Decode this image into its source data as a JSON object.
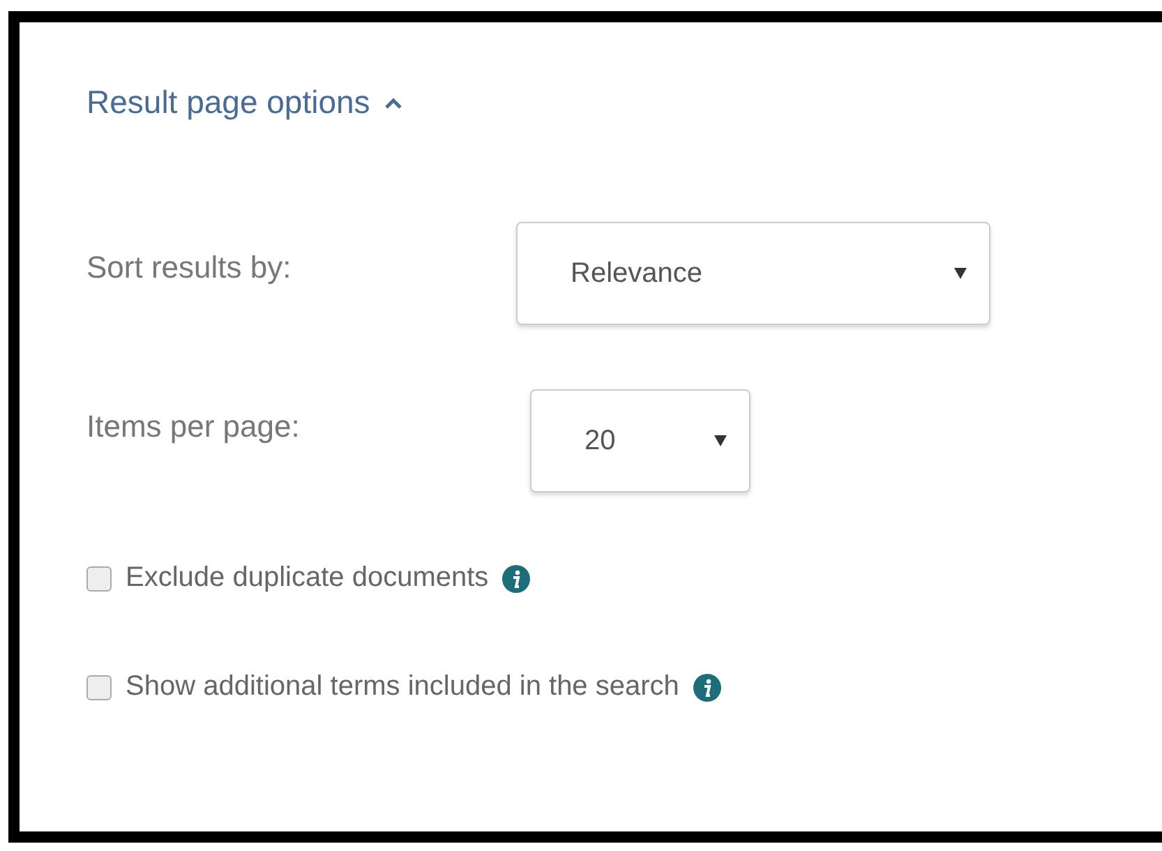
{
  "panel": {
    "title": "Result page options",
    "expanded": true,
    "selects": [
      {
        "label": "Sort results by:",
        "value": "Relevance",
        "kind": "wide"
      },
      {
        "label": "Items per page:",
        "value": "20",
        "kind": "narrow"
      }
    ],
    "options": [
      {
        "label": "Exclude duplicate documents",
        "checked": false
      },
      {
        "label": "Show additional terms included in the search",
        "checked": false
      }
    ]
  }
}
